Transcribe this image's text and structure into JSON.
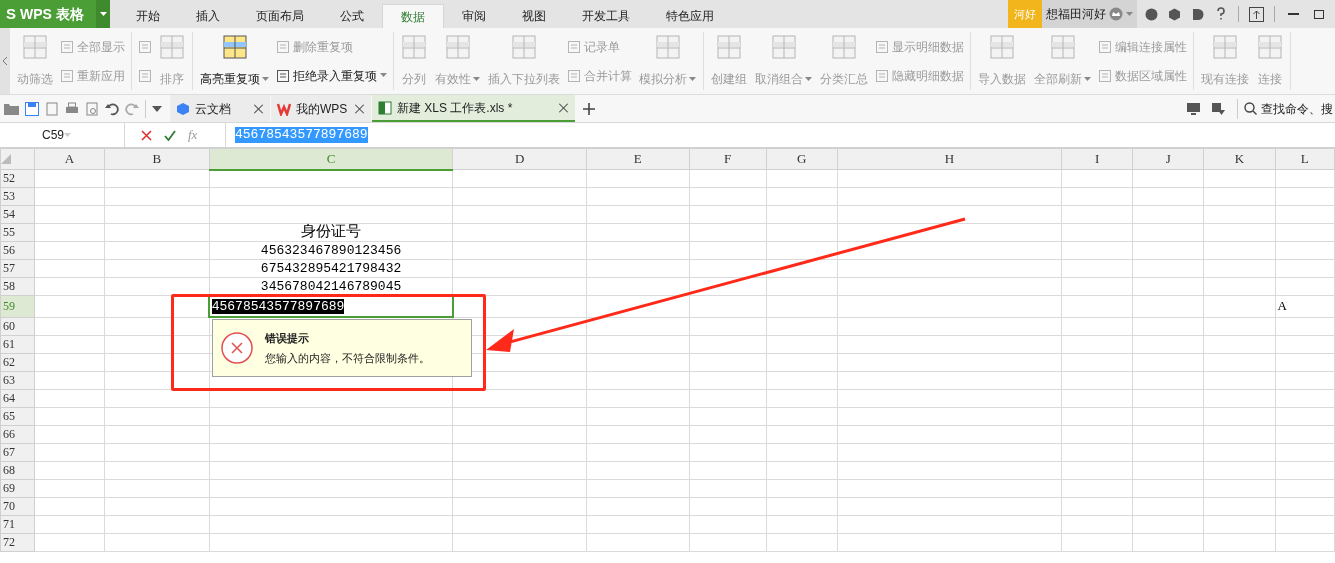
{
  "app": {
    "logo": "S",
    "title": "WPS 表格"
  },
  "menu_tabs": [
    {
      "label": "开始",
      "selected": false
    },
    {
      "label": "插入",
      "selected": false
    },
    {
      "label": "页面布局",
      "selected": false
    },
    {
      "label": "公式",
      "selected": false
    },
    {
      "label": "数据",
      "selected": true
    },
    {
      "label": "审阅",
      "selected": false
    },
    {
      "label": "视图",
      "selected": false
    },
    {
      "label": "开发工具",
      "selected": false
    },
    {
      "label": "特色应用",
      "selected": false
    }
  ],
  "account": {
    "badge": "河好",
    "user": "想福田河好"
  },
  "ribbon": [
    {
      "columns": [
        {
          "kind": "large",
          "label": "动筛选",
          "disabled": true,
          "dropdown": false
        },
        {
          "kind": "small",
          "items": [
            {
              "label": "全部显示",
              "disabled": true,
              "dropdown": false
            },
            {
              "label": "重新应用",
              "disabled": true,
              "dropdown": false
            }
          ]
        }
      ]
    },
    {
      "columns": [
        {
          "kind": "small",
          "items": [
            {
              "disabled": true,
              "dropdown": false
            },
            {
              "disabled": true,
              "dropdown": false
            }
          ]
        },
        {
          "kind": "large",
          "label": "排序",
          "disabled": true,
          "dropdown": false
        }
      ]
    },
    {
      "columns": [
        {
          "kind": "large",
          "label": "高亮重复项",
          "disabled": false,
          "dropdown": true
        },
        {
          "kind": "small",
          "items": [
            {
              "label": "删除重复项",
              "disabled": true,
              "dropdown": false
            },
            {
              "label": "拒绝录入重复项",
              "disabled": false,
              "dropdown": true
            }
          ]
        }
      ]
    },
    {
      "columns": [
        {
          "kind": "large",
          "label": "分列",
          "disabled": true,
          "dropdown": false
        },
        {
          "kind": "large",
          "label": "有效性",
          "disabled": true,
          "dropdown": true
        },
        {
          "kind": "large",
          "label": "插入下拉列表",
          "disabled": true,
          "dropdown": false
        },
        {
          "kind": "small",
          "items": [
            {
              "label": "记录单",
              "disabled": true,
              "dropdown": false
            },
            {
              "label": "合并计算",
              "disabled": true,
              "dropdown": false
            }
          ]
        },
        {
          "kind": "large",
          "label": "模拟分析",
          "disabled": true,
          "dropdown": true
        }
      ]
    },
    {
      "columns": [
        {
          "kind": "large",
          "label": "创建组",
          "disabled": true,
          "dropdown": false
        },
        {
          "kind": "large",
          "label": "取消组合",
          "disabled": true,
          "dropdown": true
        },
        {
          "kind": "large",
          "label": "分类汇总",
          "disabled": true,
          "dropdown": false
        },
        {
          "kind": "small",
          "items": [
            {
              "label": "显示明细数据",
              "disabled": true,
              "dropdown": false
            },
            {
              "label": "隐藏明细数据",
              "disabled": true,
              "dropdown": false
            }
          ]
        }
      ]
    },
    {
      "columns": [
        {
          "kind": "large",
          "label": "导入数据",
          "disabled": true,
          "dropdown": false
        },
        {
          "kind": "large",
          "label": "全部刷新",
          "disabled": true,
          "dropdown": true
        },
        {
          "kind": "small",
          "items": [
            {
              "label": "编辑连接属性",
              "disabled": true,
              "dropdown": false
            },
            {
              "label": "数据区域属性",
              "disabled": true,
              "dropdown": false
            }
          ]
        }
      ]
    },
    {
      "columns": [
        {
          "kind": "large",
          "label": "现有连接",
          "disabled": true,
          "dropdown": false
        },
        {
          "kind": "large",
          "label": "连接",
          "disabled": true,
          "dropdown": false
        }
      ]
    }
  ],
  "doc_tabs": [
    {
      "label": "云文档",
      "kind": "cloud",
      "selected": false
    },
    {
      "label": "我的WPS",
      "kind": "wps",
      "selected": false
    },
    {
      "label": "新建 XLS 工作表.xls *",
      "kind": "sheet",
      "selected": true
    }
  ],
  "search": {
    "placeholder": "查找命令、搜"
  },
  "formula_bar": {
    "cell": "C59",
    "fx": "fx",
    "value": "45678543577897689"
  },
  "columns": [
    {
      "label": "A",
      "selected": false
    },
    {
      "label": "B",
      "selected": false
    },
    {
      "label": "C",
      "selected": true
    },
    {
      "label": "D",
      "selected": false
    },
    {
      "label": "E",
      "selected": false
    },
    {
      "label": "F",
      "selected": false
    },
    {
      "label": "G",
      "selected": false
    },
    {
      "label": "H",
      "selected": false
    },
    {
      "label": "I",
      "selected": false
    },
    {
      "label": "J",
      "selected": false
    },
    {
      "label": "K",
      "selected": false
    },
    {
      "label": "L",
      "selected": false
    }
  ],
  "rows": [
    {
      "label": "52",
      "selected": false,
      "cells": {}
    },
    {
      "label": "53",
      "selected": false,
      "cells": {}
    },
    {
      "label": "54",
      "selected": false,
      "cells": {}
    },
    {
      "label": "55",
      "selected": false,
      "cells": {
        "C": "身份证号"
      }
    },
    {
      "label": "56",
      "selected": false,
      "cells": {
        "C": "456323467890123456"
      }
    },
    {
      "label": "57",
      "selected": false,
      "cells": {
        "C": "675432895421798432"
      }
    },
    {
      "label": "58",
      "selected": false,
      "cells": {
        "C": "345678042146789045"
      }
    },
    {
      "label": "59",
      "selected": true,
      "cells": {
        "C": "45678543577897689",
        "L": "A"
      }
    },
    {
      "label": "60",
      "selected": false,
      "cells": {}
    },
    {
      "label": "61",
      "selected": false,
      "cells": {}
    },
    {
      "label": "62",
      "selected": false,
      "cells": {}
    },
    {
      "label": "63",
      "selected": false,
      "cells": {}
    },
    {
      "label": "64",
      "selected": false,
      "cells": {}
    },
    {
      "label": "65",
      "selected": false,
      "cells": {}
    },
    {
      "label": "66",
      "selected": false,
      "cells": {}
    },
    {
      "label": "67",
      "selected": false,
      "cells": {}
    },
    {
      "label": "68",
      "selected": false,
      "cells": {}
    },
    {
      "label": "69",
      "selected": false,
      "cells": {}
    },
    {
      "label": "70",
      "selected": false,
      "cells": {}
    },
    {
      "label": "71",
      "selected": false,
      "cells": {}
    },
    {
      "label": "72",
      "selected": false,
      "cells": {}
    }
  ],
  "error_tip": {
    "title": "错误提示",
    "message": "您输入的内容，不符合限制条件。"
  }
}
